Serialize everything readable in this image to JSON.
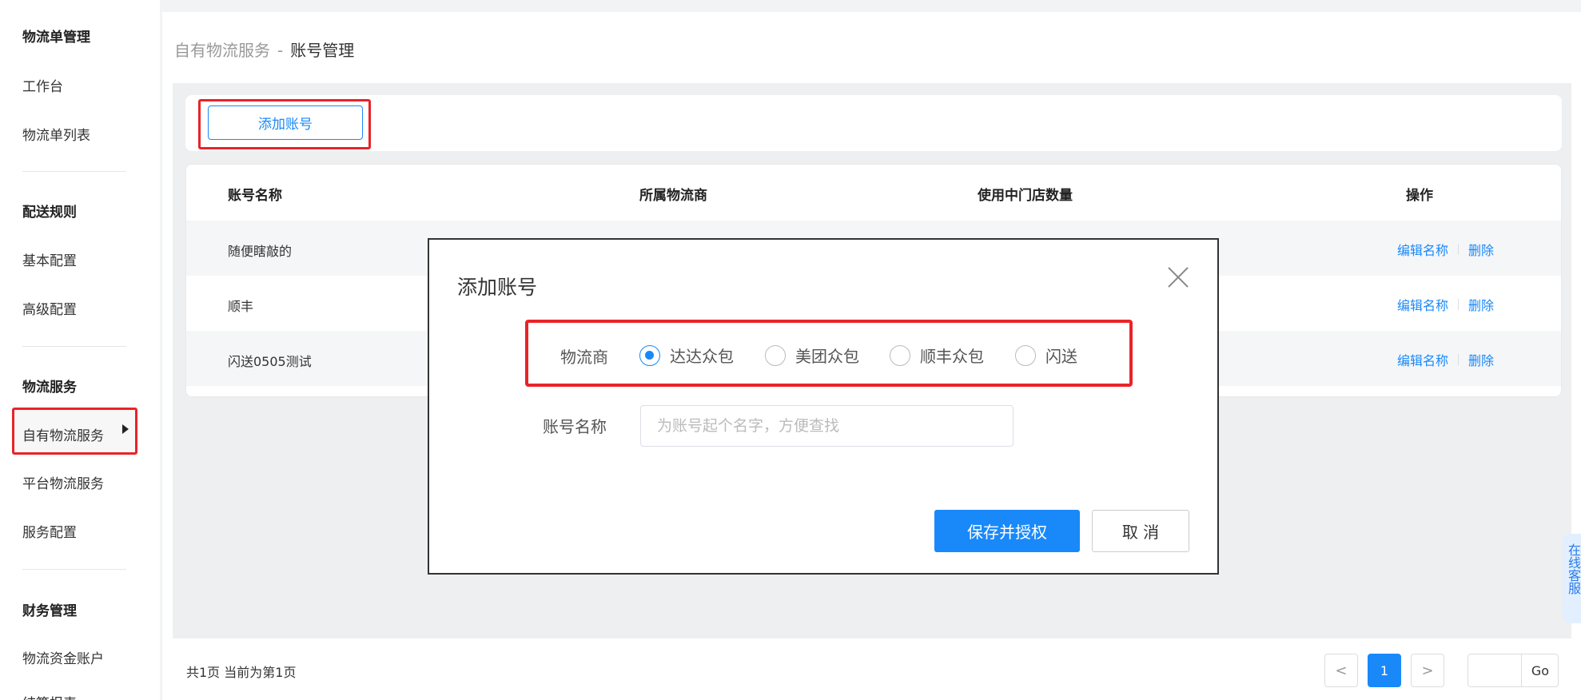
{
  "sidebar": {
    "groups": [
      {
        "title": "物流单管理",
        "items": [
          "工作台",
          "物流单列表"
        ]
      },
      {
        "title": "配送规则",
        "items": [
          "基本配置",
          "高级配置"
        ]
      },
      {
        "title": "物流服务",
        "items": [
          "自有物流服务",
          "平台物流服务",
          "服务配置"
        ]
      },
      {
        "title": "财务管理",
        "items": [
          "物流资金账户",
          "结算报表"
        ]
      }
    ]
  },
  "breadcrumb": {
    "parent": "自有物流服务",
    "separator": "-",
    "current": "账号管理"
  },
  "toolbar": {
    "add_label": "添加账号"
  },
  "table": {
    "columns": [
      "账号名称",
      "所属物流商",
      "使用中门店数量",
      "操作"
    ],
    "rows": [
      {
        "name": "随便瞎敲的",
        "carrier": "",
        "stores": ""
      },
      {
        "name": "顺丰",
        "carrier": "",
        "stores": ""
      },
      {
        "name": "闪送0505测试",
        "carrier": "",
        "stores": ""
      }
    ],
    "actions": {
      "edit": "编辑名称",
      "delete": "删除"
    }
  },
  "pagination": {
    "summary": "共1页 当前为第1页",
    "current": "1",
    "prev": "<",
    "next": ">",
    "go": "Go"
  },
  "service_tab": {
    "label": "在线客服"
  },
  "modal": {
    "title": "添加账号",
    "carrier_label": "物流商",
    "carriers": [
      {
        "label": "达达众包",
        "checked": true
      },
      {
        "label": "美团众包",
        "checked": false
      },
      {
        "label": "顺丰众包",
        "checked": false
      },
      {
        "label": "闪送",
        "checked": false
      }
    ],
    "name_label": "账号名称",
    "name_placeholder": "为账号起个名字，方便查找",
    "name_value": "",
    "save_label": "保存并授权",
    "cancel_label": "取 消"
  },
  "colors": {
    "accent": "#1989fa",
    "highlight": "#e82428"
  }
}
